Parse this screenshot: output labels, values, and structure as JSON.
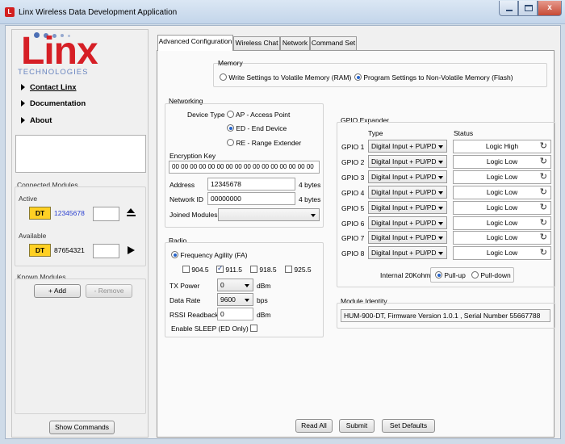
{
  "window": {
    "title": "Linx Wireless Data Development Application",
    "close_glyph": "x"
  },
  "logo": {
    "word": "Linx",
    "sub": "TECHNOLOGIES",
    "app_badge": "L"
  },
  "nav": {
    "contact": "Contact Linx",
    "documentation": "Documentation",
    "about": "About"
  },
  "connected": {
    "title": "Connected Modules",
    "active_label": "Active",
    "active": {
      "badge": "DT",
      "id": "12345678"
    },
    "available_label": "Available",
    "available": {
      "badge": "DT",
      "id": "87654321"
    }
  },
  "known": {
    "title": "Known Modules",
    "add": "+ Add",
    "remove": "- Remove"
  },
  "show_commands": "Show Commands",
  "tabs": [
    "Advanced Configuration",
    "Wireless Chat",
    "Network",
    "Command Set"
  ],
  "memory": {
    "title": "Memory",
    "opt_ram": "Write Settings to Volatile Memory (RAM)",
    "opt_flash": "Program Settings to Non-Volatile Memory (Flash)"
  },
  "networking": {
    "title": "Networking",
    "device_type_label": "Device Type",
    "types": [
      "AP - Access Point",
      "ED - End Device",
      "RE - Range Extender"
    ],
    "selected_type": 1,
    "enc_label": "Encryption Key",
    "enc_value": "00 00 00 00 00 00 00 00 00 00 00 00 00 00 00 00",
    "address_label": "Address",
    "address_value": "12345678",
    "address_unit": "4 bytes",
    "netid_label": "Network ID",
    "netid_value": "00000000",
    "netid_unit": "4 bytes",
    "joined_label": "Joined Modules",
    "joined_value": ""
  },
  "radio": {
    "title": "Radio",
    "fa_label": "Frequency Agility (FA)",
    "freqs": [
      {
        "label": "904.5",
        "checked": false
      },
      {
        "label": "911.5",
        "checked": true
      },
      {
        "label": "918.5",
        "checked": false
      },
      {
        "label": "925.5",
        "checked": false
      }
    ],
    "tx_label": "TX Power",
    "tx_value": "0",
    "tx_unit": "dBm",
    "rate_label": "Data Rate",
    "rate_value": "9600",
    "rate_unit": "bps",
    "rssi_label": "RSSI Readback",
    "rssi_value": "0",
    "rssi_unit": "dBm",
    "sleep_label": "Enable SLEEP (ED Only)"
  },
  "gpio": {
    "title": "GPIO Expander",
    "col_type": "Type",
    "col_status": "Status",
    "rows": [
      {
        "name": "GPIO 1",
        "type": "Digital Input + PU/PD",
        "status": "Logic High"
      },
      {
        "name": "GPIO 2",
        "type": "Digital Input + PU/PD",
        "status": "Logic Low"
      },
      {
        "name": "GPIO 3",
        "type": "Digital Input + PU/PD",
        "status": "Logic Low"
      },
      {
        "name": "GPIO 4",
        "type": "Digital Input + PU/PD",
        "status": "Logic Low"
      },
      {
        "name": "GPIO 5",
        "type": "Digital Input + PU/PD",
        "status": "Logic Low"
      },
      {
        "name": "GPIO 6",
        "type": "Digital Input + PU/PD",
        "status": "Logic Low"
      },
      {
        "name": "GPIO 7",
        "type": "Digital Input + PU/PD",
        "status": "Logic Low"
      },
      {
        "name": "GPIO 8",
        "type": "Digital Input + PU/PD",
        "status": "Logic Low"
      }
    ],
    "pull_label": "Internal 20Kohm",
    "pull_up": "Pull-up",
    "pull_down": "Pull-down"
  },
  "identity": {
    "title": "Module Identity",
    "value": "HUM-900-DT, Firmware Version 1.0.1  , Serial Number 55667788"
  },
  "buttons": {
    "read_all": "Read All",
    "submit": "Submit",
    "set_defaults": "Set Defaults"
  },
  "colors": {
    "logo_red": "#d61f26",
    "logo_blue": "#4c6fb5",
    "badge_yellow": "#ffd024",
    "id_blue": "#2a3fd0"
  }
}
